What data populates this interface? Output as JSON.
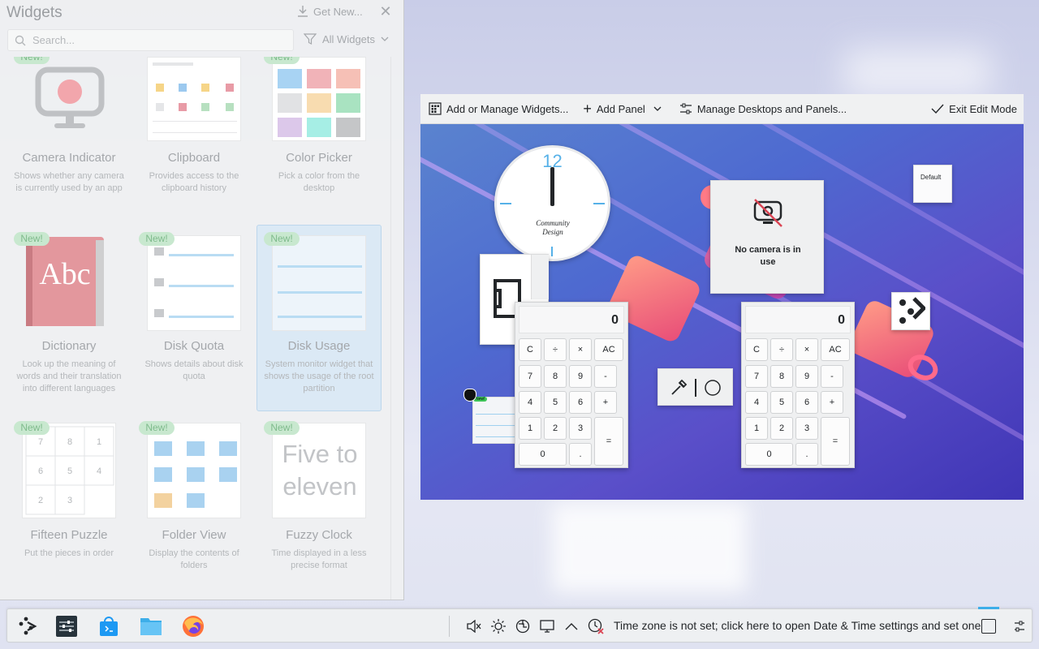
{
  "widgets_panel": {
    "title": "Widgets",
    "get_new_label": "Get New...",
    "search_placeholder": "Search...",
    "filter_label": "All Widgets",
    "new_badge": "New!",
    "items": [
      {
        "name": "Camera Indicator",
        "desc": "Shows whether any camera is currently used by an app",
        "icon": "camera-icon"
      },
      {
        "name": "Clipboard",
        "desc": "Provides access to the clipboard history",
        "icon": "clipboard-icon"
      },
      {
        "name": "Color Picker",
        "desc": "Pick a color from the desktop",
        "icon": "color-picker-icon"
      },
      {
        "name": "Dictionary",
        "desc": "Look up the meaning of words and their translation into different languages",
        "icon": "dictionary-icon",
        "thumb_text": "Abc"
      },
      {
        "name": "Disk Quota",
        "desc": "Shows details about disk quota",
        "icon": "disk-quota-icon"
      },
      {
        "name": "Disk Usage",
        "desc": "System monitor widget that shows the usage of the root partition",
        "icon": "disk-usage-icon"
      },
      {
        "name": "Fifteen Puzzle",
        "desc": "Put the pieces in order",
        "icon": "puzzle-icon"
      },
      {
        "name": "Folder View",
        "desc": "Display the contents of folders",
        "icon": "folder-view-icon"
      },
      {
        "name": "Fuzzy Clock",
        "desc": "Time displayed in a less precise format",
        "icon": "fuzzy-clock-icon",
        "thumb_text": "Five to eleven"
      }
    ]
  },
  "edit_toolbar": {
    "add_widgets": "Add or Manage Widgets...",
    "add_panel": "Add Panel",
    "manage_desktops": "Manage Desktops and Panels...",
    "exit_edit": "Exit Edit Mode"
  },
  "desktop": {
    "clock_number": "12",
    "clock_brand": "Community Design",
    "camera_status": "No camera is in use",
    "default_label": "Default",
    "calc_display": "0",
    "calc_keys": [
      "C",
      "÷",
      "×",
      "AC",
      "7",
      "8",
      "9",
      "-",
      "4",
      "5",
      "6",
      "+",
      "1",
      "2",
      "3",
      "=",
      "0",
      "."
    ]
  },
  "taskbar": {
    "apps": [
      "app-launcher-icon",
      "system-settings-icon",
      "discover-icon",
      "dolphin-icon",
      "firefox-icon"
    ],
    "tray_icons": [
      "mute-icon",
      "brightness-icon",
      "network-icon",
      "display-icon",
      "expand-tray-icon",
      "clock-warning-icon"
    ],
    "time_zone_text": "Time zone is not set; click here to open Date & Time settings and set one"
  },
  "colors": {
    "accent": "#3daee9",
    "new_badge_bg": "#c8e8cf",
    "selected_bg": "#dbe9f5"
  }
}
